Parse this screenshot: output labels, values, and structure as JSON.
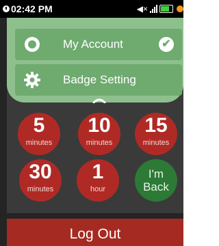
{
  "status_bar": {
    "time": "02:42 PM",
    "mute_glyph": "◀×",
    "icons": [
      "clock-icon",
      "mute-icon",
      "signal-icon",
      "battery-icon",
      "notification-icon"
    ],
    "battery_color": "#3cd23c",
    "notification_color": "#f39a17"
  },
  "menu": {
    "items": [
      {
        "label": "My Account",
        "icon": "radio-icon",
        "trailing_icon": "check-icon",
        "selected": true
      },
      {
        "label": "Badge Setting",
        "icon": "gear-icon"
      }
    ],
    "check_glyph": "✔",
    "background_color": "#8ec08e",
    "item_color": "#6faa6f"
  },
  "timers": [
    {
      "value": "5",
      "unit": "minutes"
    },
    {
      "value": "10",
      "unit": "minutes"
    },
    {
      "value": "15",
      "unit": "minutes"
    },
    {
      "value": "30",
      "unit": "minutes"
    },
    {
      "value": "1",
      "unit": "hour"
    }
  ],
  "im_back": {
    "line1": "I'm",
    "line2": "Back"
  },
  "logout": {
    "label": "Log Out"
  },
  "colors": {
    "timer_red": "#b02a25",
    "im_back_green": "#2c7a35",
    "logout_red": "#a52a21"
  }
}
